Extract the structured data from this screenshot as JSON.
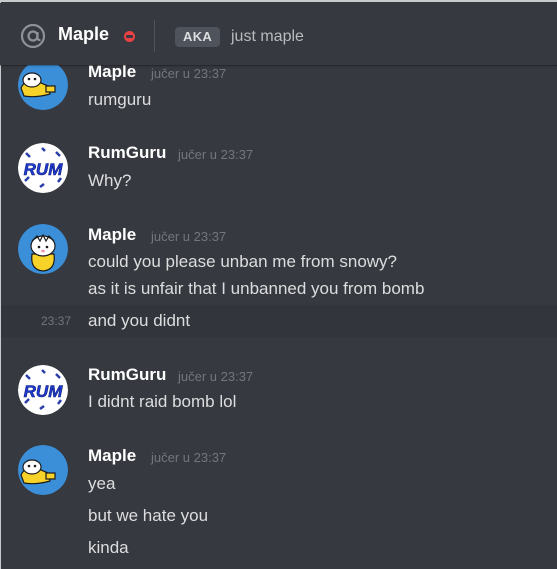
{
  "header": {
    "icon": "at-icon",
    "dm_name": "Maple",
    "status": "do-not-disturb",
    "status_color": "#ed4245",
    "aka_label": "AKA",
    "aka_nick": "just maple"
  },
  "messages": [
    {
      "author": "Maple",
      "timestamp": "jučer u 23:37",
      "lines": [
        "rumguru"
      ]
    },
    {
      "author": "RumGuru",
      "timestamp": "jučer u 23:37",
      "lines": [
        "Why?"
      ]
    },
    {
      "author": "Maple",
      "timestamp": "jučer u 23:37",
      "lines": [
        "could you please unban me from snowy?",
        "as it is unfair that I unbanned you from bomb"
      ]
    },
    {
      "author": "",
      "timestamp": "23:37",
      "lines": [
        "and you didnt"
      ]
    },
    {
      "author": "RumGuru",
      "timestamp": "jučer u 23:37",
      "lines": [
        "I didnt raid bomb lol"
      ]
    },
    {
      "author": "Maple",
      "timestamp": "jučer u 23:37",
      "lines": [
        "yea",
        "but we hate you",
        "kinda"
      ]
    }
  ],
  "avatars": {
    "maple": "Maple avatar",
    "rumguru": "RumGuru avatar",
    "rumguru_text": "RUM"
  },
  "colors": {
    "background": "#36393f",
    "author": "#ffffff",
    "timestamp": "#72767d",
    "text": "#dcddde",
    "maple_avatar_bg": "#3b8ed8",
    "rumguru_accent": "#1f3bd1"
  }
}
